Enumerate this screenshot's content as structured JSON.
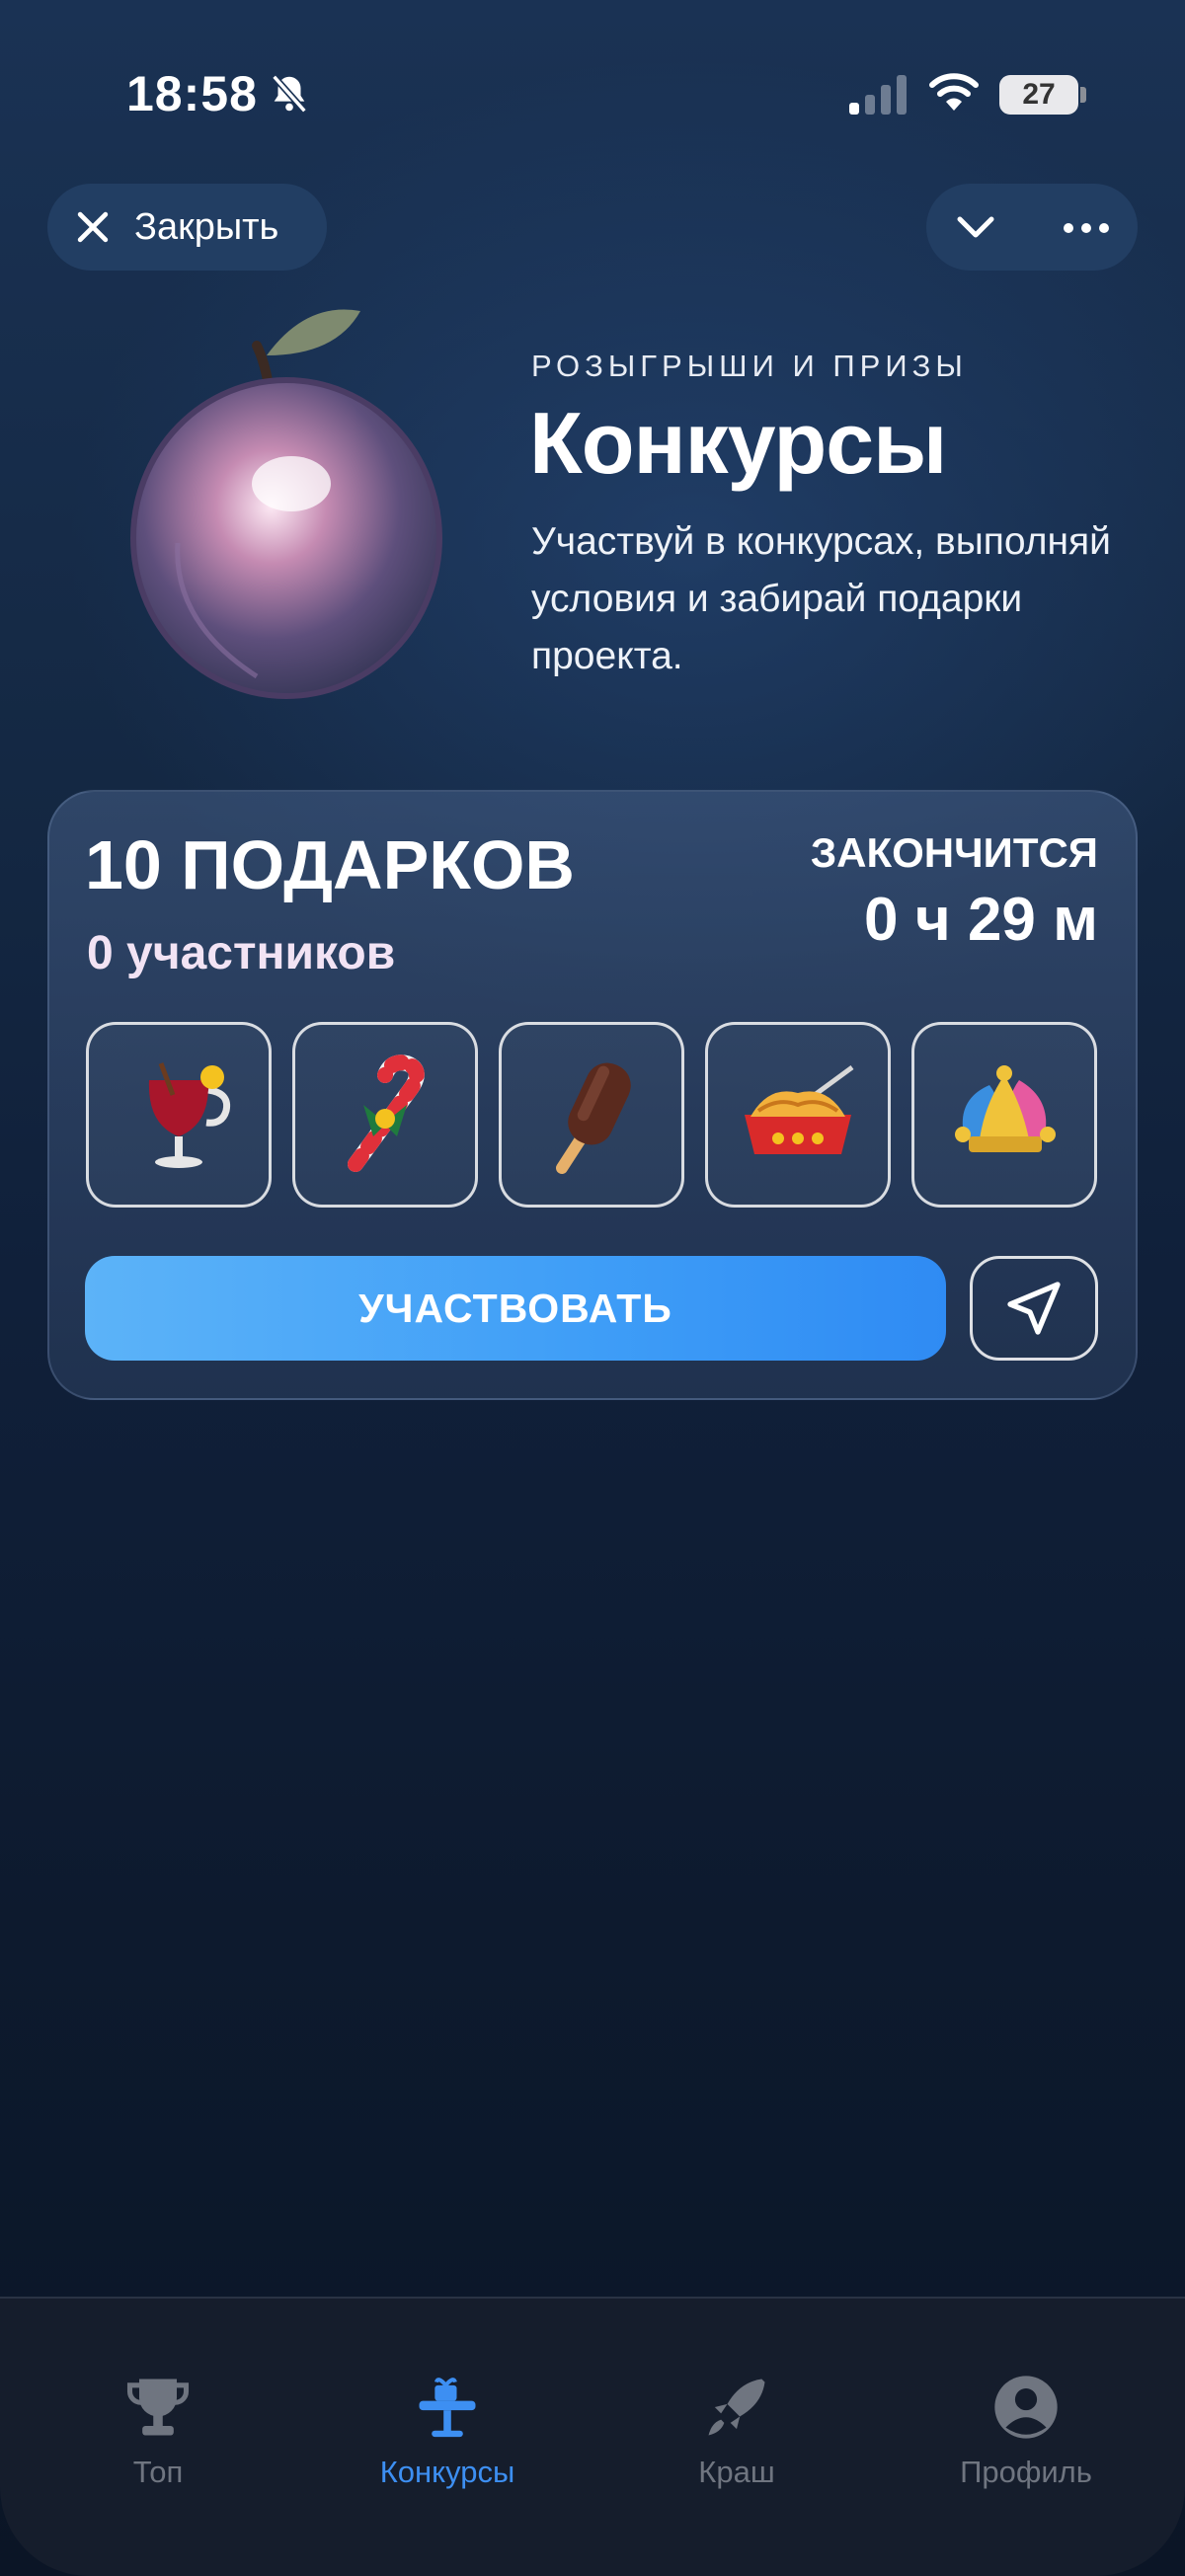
{
  "status_bar": {
    "time": "18:58",
    "battery": "27"
  },
  "header": {
    "close_label": "Закрыть"
  },
  "hero": {
    "eyebrow": "РОЗЫГРЫШИ И ПРИЗЫ",
    "title": "Конкурсы",
    "description": "Участвуй в конкурсах, выполняй условия и забирай подарки проекта."
  },
  "contest": {
    "gifts_title": "10 ПОДАРКОВ",
    "participants": "0 участников",
    "ends_label": "ЗАКОНЧИТСЯ",
    "ends_time": "0 ч 29 м",
    "gifts": [
      "mulled-wine-icon",
      "candy-cane-icon",
      "ice-cream-icon",
      "noodles-box-icon",
      "jester-hat-icon"
    ],
    "join_label": "УЧАСТВОВАТЬ"
  },
  "nav": {
    "items": [
      {
        "label": "Топ",
        "icon": "trophy-icon",
        "active": false
      },
      {
        "label": "Конкурсы",
        "icon": "contest-icon",
        "active": true
      },
      {
        "label": "Краш",
        "icon": "rocket-icon",
        "active": false
      },
      {
        "label": "Профиль",
        "icon": "profile-icon",
        "active": false
      }
    ]
  },
  "colors": {
    "accent": "#3d8ff2",
    "button_start": "#5cb3f8",
    "button_end": "#2f8bf3",
    "background": "#10203a"
  }
}
